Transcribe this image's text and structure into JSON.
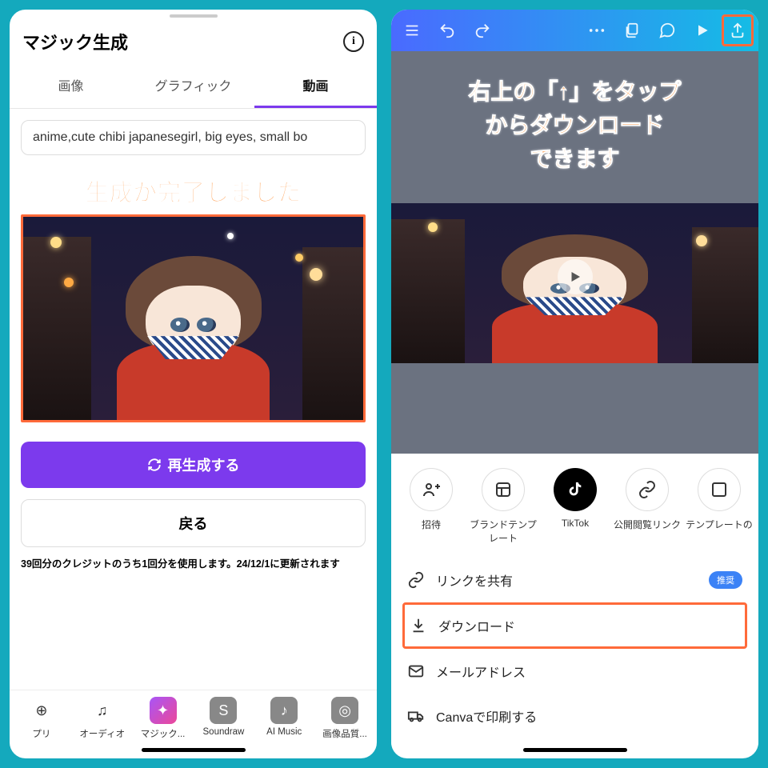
{
  "left": {
    "title": "マジック生成",
    "tabs": {
      "image": "画像",
      "graphic": "グラフィック",
      "video": "動画"
    },
    "prompt": "anime,cute chibi japanesegirl, big eyes, small bo",
    "overlay": "生成が完了しました",
    "regenerate": "再生成する",
    "back": "戻る",
    "credit": "39回分のクレジットのうち1回分を使用します。24/12/1に更新されます",
    "nav": {
      "app": "プリ",
      "audio": "オーディオ",
      "magic": "マジック...",
      "soundraw": "Soundraw",
      "aimusic": "AI Music",
      "quality": "画像品質..."
    }
  },
  "right": {
    "overlay_l1": "右上の「↑」をタップ",
    "overlay_l2": "からダウンロード",
    "overlay_l3": "できます",
    "share": {
      "invite": "招待",
      "brand": "ブランドテンプレート",
      "tiktok": "TikTok",
      "public": "公開閲覧リンク",
      "template": "テンプレートの"
    },
    "options": {
      "link": "リンクを共有",
      "badge": "推奨",
      "download": "ダウンロード",
      "email": "メールアドレス",
      "print": "Canvaで印刷する"
    }
  }
}
